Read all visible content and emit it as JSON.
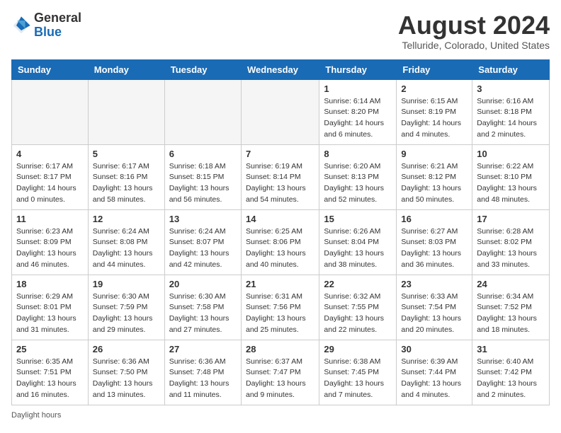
{
  "header": {
    "logo_general": "General",
    "logo_blue": "Blue",
    "month_year": "August 2024",
    "location": "Telluride, Colorado, United States"
  },
  "days_of_week": [
    "Sunday",
    "Monday",
    "Tuesday",
    "Wednesday",
    "Thursday",
    "Friday",
    "Saturday"
  ],
  "weeks": [
    [
      {
        "day": "",
        "info": ""
      },
      {
        "day": "",
        "info": ""
      },
      {
        "day": "",
        "info": ""
      },
      {
        "day": "",
        "info": ""
      },
      {
        "day": "1",
        "info": "Sunrise: 6:14 AM\nSunset: 8:20 PM\nDaylight: 14 hours\nand 6 minutes."
      },
      {
        "day": "2",
        "info": "Sunrise: 6:15 AM\nSunset: 8:19 PM\nDaylight: 14 hours\nand 4 minutes."
      },
      {
        "day": "3",
        "info": "Sunrise: 6:16 AM\nSunset: 8:18 PM\nDaylight: 14 hours\nand 2 minutes."
      }
    ],
    [
      {
        "day": "4",
        "info": "Sunrise: 6:17 AM\nSunset: 8:17 PM\nDaylight: 14 hours\nand 0 minutes."
      },
      {
        "day": "5",
        "info": "Sunrise: 6:17 AM\nSunset: 8:16 PM\nDaylight: 13 hours\nand 58 minutes."
      },
      {
        "day": "6",
        "info": "Sunrise: 6:18 AM\nSunset: 8:15 PM\nDaylight: 13 hours\nand 56 minutes."
      },
      {
        "day": "7",
        "info": "Sunrise: 6:19 AM\nSunset: 8:14 PM\nDaylight: 13 hours\nand 54 minutes."
      },
      {
        "day": "8",
        "info": "Sunrise: 6:20 AM\nSunset: 8:13 PM\nDaylight: 13 hours\nand 52 minutes."
      },
      {
        "day": "9",
        "info": "Sunrise: 6:21 AM\nSunset: 8:12 PM\nDaylight: 13 hours\nand 50 minutes."
      },
      {
        "day": "10",
        "info": "Sunrise: 6:22 AM\nSunset: 8:10 PM\nDaylight: 13 hours\nand 48 minutes."
      }
    ],
    [
      {
        "day": "11",
        "info": "Sunrise: 6:23 AM\nSunset: 8:09 PM\nDaylight: 13 hours\nand 46 minutes."
      },
      {
        "day": "12",
        "info": "Sunrise: 6:24 AM\nSunset: 8:08 PM\nDaylight: 13 hours\nand 44 minutes."
      },
      {
        "day": "13",
        "info": "Sunrise: 6:24 AM\nSunset: 8:07 PM\nDaylight: 13 hours\nand 42 minutes."
      },
      {
        "day": "14",
        "info": "Sunrise: 6:25 AM\nSunset: 8:06 PM\nDaylight: 13 hours\nand 40 minutes."
      },
      {
        "day": "15",
        "info": "Sunrise: 6:26 AM\nSunset: 8:04 PM\nDaylight: 13 hours\nand 38 minutes."
      },
      {
        "day": "16",
        "info": "Sunrise: 6:27 AM\nSunset: 8:03 PM\nDaylight: 13 hours\nand 36 minutes."
      },
      {
        "day": "17",
        "info": "Sunrise: 6:28 AM\nSunset: 8:02 PM\nDaylight: 13 hours\nand 33 minutes."
      }
    ],
    [
      {
        "day": "18",
        "info": "Sunrise: 6:29 AM\nSunset: 8:01 PM\nDaylight: 13 hours\nand 31 minutes."
      },
      {
        "day": "19",
        "info": "Sunrise: 6:30 AM\nSunset: 7:59 PM\nDaylight: 13 hours\nand 29 minutes."
      },
      {
        "day": "20",
        "info": "Sunrise: 6:30 AM\nSunset: 7:58 PM\nDaylight: 13 hours\nand 27 minutes."
      },
      {
        "day": "21",
        "info": "Sunrise: 6:31 AM\nSunset: 7:56 PM\nDaylight: 13 hours\nand 25 minutes."
      },
      {
        "day": "22",
        "info": "Sunrise: 6:32 AM\nSunset: 7:55 PM\nDaylight: 13 hours\nand 22 minutes."
      },
      {
        "day": "23",
        "info": "Sunrise: 6:33 AM\nSunset: 7:54 PM\nDaylight: 13 hours\nand 20 minutes."
      },
      {
        "day": "24",
        "info": "Sunrise: 6:34 AM\nSunset: 7:52 PM\nDaylight: 13 hours\nand 18 minutes."
      }
    ],
    [
      {
        "day": "25",
        "info": "Sunrise: 6:35 AM\nSunset: 7:51 PM\nDaylight: 13 hours\nand 16 minutes."
      },
      {
        "day": "26",
        "info": "Sunrise: 6:36 AM\nSunset: 7:50 PM\nDaylight: 13 hours\nand 13 minutes."
      },
      {
        "day": "27",
        "info": "Sunrise: 6:36 AM\nSunset: 7:48 PM\nDaylight: 13 hours\nand 11 minutes."
      },
      {
        "day": "28",
        "info": "Sunrise: 6:37 AM\nSunset: 7:47 PM\nDaylight: 13 hours\nand 9 minutes."
      },
      {
        "day": "29",
        "info": "Sunrise: 6:38 AM\nSunset: 7:45 PM\nDaylight: 13 hours\nand 7 minutes."
      },
      {
        "day": "30",
        "info": "Sunrise: 6:39 AM\nSunset: 7:44 PM\nDaylight: 13 hours\nand 4 minutes."
      },
      {
        "day": "31",
        "info": "Sunrise: 6:40 AM\nSunset: 7:42 PM\nDaylight: 13 hours\nand 2 minutes."
      }
    ]
  ],
  "footer": {
    "note": "Daylight hours"
  }
}
